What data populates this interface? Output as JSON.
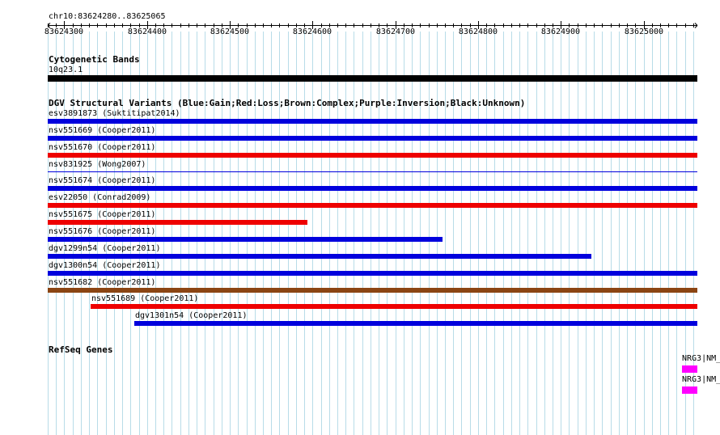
{
  "region": {
    "label": "chr10:83624280..83625065",
    "start": 83624280,
    "end": 83625065
  },
  "ruler": {
    "ticks": [
      "83624300",
      "83624400",
      "83624500",
      "83624600",
      "83624700",
      "83624800",
      "83624900",
      "83625000"
    ]
  },
  "cytoband": {
    "title": "Cytogenetic Bands",
    "band": "10q23.1",
    "color": "#000000"
  },
  "dgv": {
    "title": "DGV Structural Variants (Blue:Gain;Red:Loss;Brown:Complex;Purple:Inversion;Black:Unknown)",
    "colors": {
      "gain": "#0000dd",
      "loss": "#ee0000",
      "complex": "#8b4513",
      "inversion": "#800080",
      "unknown": "#000000"
    },
    "variants": [
      {
        "label": "esv3891873 (Suktitipat2014)",
        "type": "gain",
        "start": 83624280,
        "end": 83625065
      },
      {
        "label": "nsv551669 (Cooper2011)",
        "type": "gain",
        "start": 83624280,
        "end": 83625065
      },
      {
        "label": "nsv551670 (Cooper2011)",
        "type": "loss",
        "start": 83624280,
        "end": 83625065
      },
      {
        "label": "nsv831925 (Wong2007)",
        "type": "gain",
        "start": 83624280,
        "end": 83625065,
        "thin": true
      },
      {
        "label": "nsv551674 (Cooper2011)",
        "type": "gain",
        "start": 83624280,
        "end": 83625065
      },
      {
        "label": "esv22050 (Conrad2009)",
        "type": "loss",
        "start": 83624280,
        "end": 83625065
      },
      {
        "label": "nsv551675 (Cooper2011)",
        "type": "loss",
        "start": 83624280,
        "end": 83624594
      },
      {
        "label": "nsv551676 (Cooper2011)",
        "type": "gain",
        "start": 83624280,
        "end": 83624757
      },
      {
        "label": "dgv1299n54 (Cooper2011)",
        "type": "gain",
        "start": 83624280,
        "end": 83624937
      },
      {
        "label": "dgv1300n54 (Cooper2011)",
        "type": "gain",
        "start": 83624280,
        "end": 83625065
      },
      {
        "label": "nsv551682 (Cooper2011)",
        "type": "complex",
        "start": 83624280,
        "end": 83625065
      },
      {
        "label": "nsv551689 (Cooper2011)",
        "type": "loss",
        "start": 83624332,
        "end": 83625065
      },
      {
        "label": "dgv1301n54 (Cooper2011)",
        "type": "gain",
        "start": 83624385,
        "end": 83625065
      }
    ]
  },
  "refseq": {
    "title": "RefSeq Genes",
    "color": "#ff00ff",
    "genes": [
      {
        "label": "NRG3|NM_"
      },
      {
        "label": "NRG3|NM_"
      }
    ]
  }
}
